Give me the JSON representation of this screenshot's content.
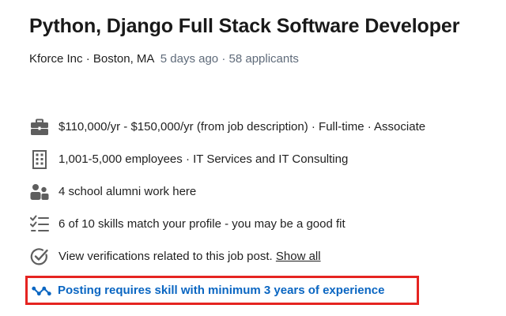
{
  "job": {
    "title": "Python, Django Full Stack Software Developer",
    "company": "Kforce Inc",
    "location": "Boston, MA",
    "posted": "5 days ago",
    "applicants": "58 applicants",
    "separator": " · "
  },
  "details": {
    "salary": "$110,000/yr - $150,000/yr (from job description) · Full-time · Associate",
    "company_size": "1,001-5,000 employees · IT Services and IT Consulting",
    "alumni": "4 school alumni work here",
    "skills": "6 of 10 skills match your profile - you may be a good fit",
    "verifications": "View verifications related to this job post. ",
    "verifications_link": "Show all",
    "requirement": "Posting requires skill with minimum 3 years of experience"
  },
  "icons": {
    "briefcase": "briefcase-icon",
    "building": "building-icon",
    "people": "people-icon",
    "checklist": "checklist-icon",
    "verified": "verified-check-icon",
    "skill": "skill-insight-icon"
  },
  "colors": {
    "muted": "#5f6b7a",
    "accent": "#0a66c2",
    "highlight_border": "#e52421",
    "icon": "#5e5e5e"
  }
}
